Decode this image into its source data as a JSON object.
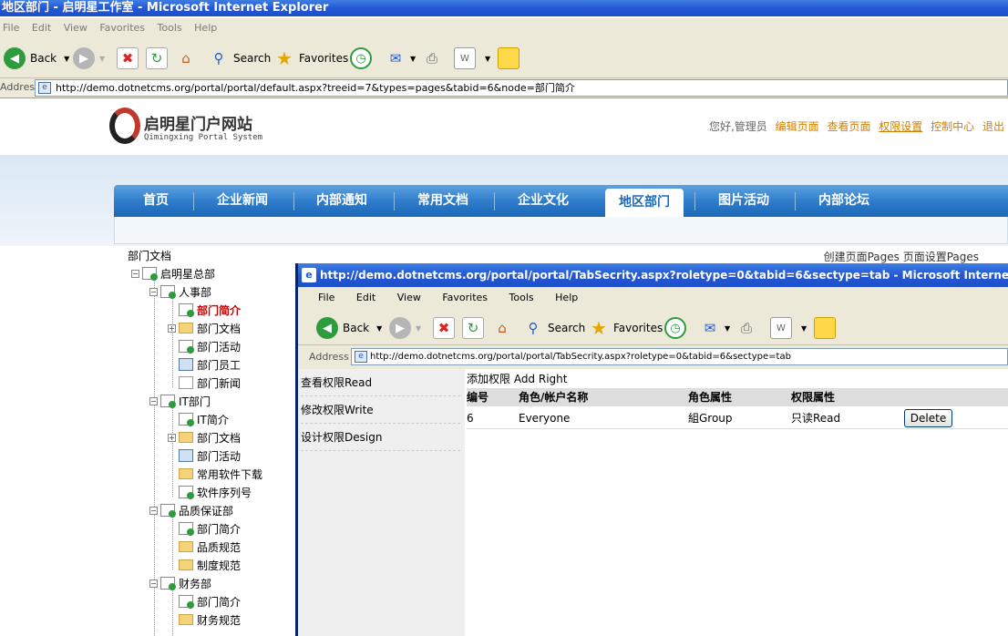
{
  "window": {
    "title": "地区部门 - 启明星工作室 - Microsoft Internet Explorer"
  },
  "menu": [
    "File",
    "Edit",
    "View",
    "Favorites",
    "Tools",
    "Help"
  ],
  "toolbar": {
    "back": "Back",
    "search": "Search",
    "favorites": "Favorites"
  },
  "address": {
    "label": "Address",
    "url": "http://demo.dotnetcms.org/portal/portal/default.aspx?treeid=7&types=pages&tabid=6&node=部门简介"
  },
  "site": {
    "logo_title": "启明星门户网站",
    "logo_subtitle": "Qimingxing Portal System",
    "greeting": "您好,管理员",
    "links": [
      "编辑页面",
      "查看页面",
      "权限设置",
      "控制中心",
      "退出"
    ],
    "nav": [
      "首页",
      "企业新闻",
      "内部通知",
      "常用文档",
      "企业文化",
      "地区部门",
      "图片活动",
      "内部论坛"
    ],
    "active_nav": "地区部门",
    "dept_label": "部门文档",
    "create_pages": "创建页面Pages 页面设置Pages"
  },
  "tree": [
    {
      "label": "启明星总部",
      "level": 0,
      "icon": "page",
      "toggle": "−"
    },
    {
      "label": "人事部",
      "level": 1,
      "icon": "page",
      "toggle": "−"
    },
    {
      "label": "部门简介",
      "level": 2,
      "icon": "page",
      "selected": true
    },
    {
      "label": "部门文档",
      "level": 2,
      "icon": "folder",
      "toggle": "+"
    },
    {
      "label": "部门活动",
      "level": 2,
      "icon": "page"
    },
    {
      "label": "部门员工",
      "level": 2,
      "icon": "doc"
    },
    {
      "label": "部门新闻",
      "level": 2,
      "icon": "note"
    },
    {
      "label": "IT部门",
      "level": 1,
      "icon": "page",
      "toggle": "−"
    },
    {
      "label": "IT简介",
      "level": 2,
      "icon": "page"
    },
    {
      "label": "部门文档",
      "level": 2,
      "icon": "folder",
      "toggle": "+"
    },
    {
      "label": "部门活动",
      "level": 2,
      "icon": "doc"
    },
    {
      "label": "常用软件下载",
      "level": 2,
      "icon": "folder"
    },
    {
      "label": "软件序列号",
      "level": 2,
      "icon": "page"
    },
    {
      "label": "品质保证部",
      "level": 1,
      "icon": "page",
      "toggle": "−"
    },
    {
      "label": "部门简介",
      "level": 2,
      "icon": "page"
    },
    {
      "label": "品质规范",
      "level": 2,
      "icon": "folder"
    },
    {
      "label": "制度规范",
      "level": 2,
      "icon": "folder"
    },
    {
      "label": "财务部",
      "level": 1,
      "icon": "page",
      "toggle": "−"
    },
    {
      "label": "部门简介",
      "level": 2,
      "icon": "page"
    },
    {
      "label": "财务规范",
      "level": 2,
      "icon": "folder"
    }
  ],
  "popup": {
    "title": "http://demo.dotnetcms.org/portal/portal/TabSecrity.aspx?roletype=0&tabid=6&sectype=tab - Microsoft Internet Explorer",
    "menu": [
      "File",
      "Edit",
      "View",
      "Favorites",
      "Tools",
      "Help"
    ],
    "address_label": "Address",
    "url": "http://demo.dotnetcms.org/portal/portal/TabSecrity.aspx?roletype=0&tabid=6&sectype=tab",
    "left_items": [
      "查看权限Read",
      "修改权限Write",
      "设计权限Design"
    ],
    "add_right": "添加权限  Add Right",
    "table": {
      "headers": [
        "编号",
        "角色/帐户名称",
        "角色属性",
        "权限属性"
      ],
      "rows": [
        {
          "id": "6",
          "name": "Everyone",
          "role": "組Group",
          "perm": "只读Read",
          "action": "Delete"
        }
      ]
    }
  }
}
